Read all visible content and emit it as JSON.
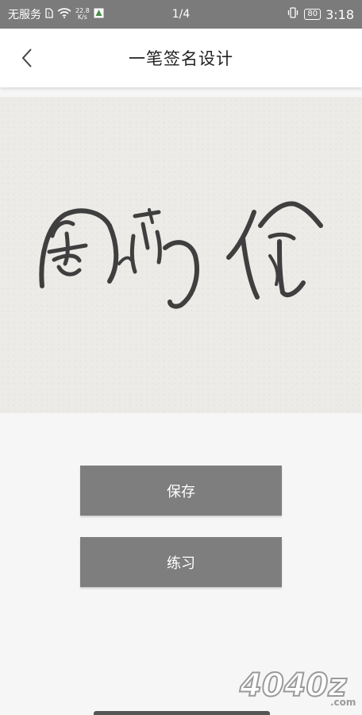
{
  "status_bar": {
    "carrier": "无服务",
    "net_speed_value": "22.8",
    "net_speed_unit": "K/s",
    "page_indicator": "1/4",
    "battery": "80",
    "time": "3:18"
  },
  "header": {
    "title": "一笔签名设计"
  },
  "actions": {
    "save_label": "保存",
    "practice_label": "练习"
  },
  "watermark": {
    "logo_text": "4040z",
    "suffix": ".com"
  }
}
